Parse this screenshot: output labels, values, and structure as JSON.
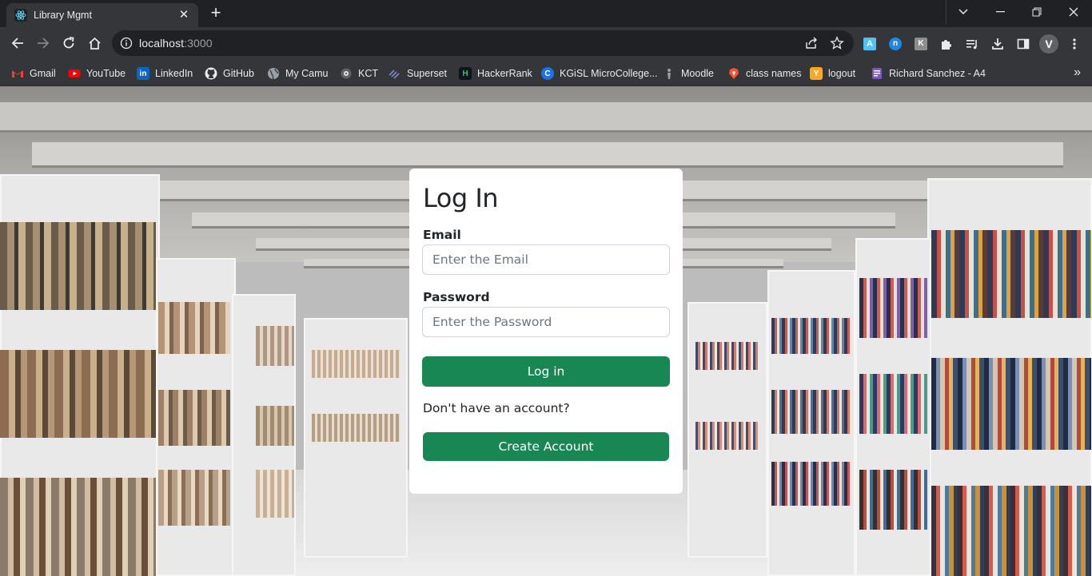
{
  "tab": {
    "title": "Library Mgmt",
    "close": "✕",
    "new_tab": "+"
  },
  "window": {
    "minimize": "—",
    "restore": "❐",
    "close": "✕",
    "tab_search": "⌄"
  },
  "address": {
    "host": "localhost",
    "port": ":3000"
  },
  "bookmarks": [
    {
      "label": "Gmail",
      "icon": "gmail-icon",
      "color": "#ea4335",
      "glyph": "M"
    },
    {
      "label": "YouTube",
      "icon": "youtube-icon",
      "color": "#ff0000",
      "glyph": "▶"
    },
    {
      "label": "LinkedIn",
      "icon": "linkedin-icon",
      "color": "#0a66c2",
      "glyph": "in"
    },
    {
      "label": "GitHub",
      "icon": "github-icon",
      "color": "#e8eaed",
      "glyph": ""
    },
    {
      "label": "My Camu",
      "icon": "globe-icon",
      "color": "#9aa0a6",
      "glyph": ""
    },
    {
      "label": "KCT",
      "icon": "kct-icon",
      "color": "#5f6368",
      "glyph": ""
    },
    {
      "label": "Superset",
      "icon": "superset-icon",
      "color": "#5c6bc0",
      "glyph": ""
    },
    {
      "label": "HackerRank",
      "icon": "hackerrank-icon",
      "color": "#0e141e",
      "glyph": "H"
    },
    {
      "label": "KGiSL MicroCollege...",
      "icon": "kgisl-icon",
      "color": "#1a73e8",
      "glyph": "C"
    },
    {
      "label": "Moodle",
      "icon": "moodle-icon",
      "color": "#9aa0a6",
      "glyph": ""
    },
    {
      "label": "class names",
      "icon": "brave-icon",
      "color": "#fb542b",
      "glyph": ""
    },
    {
      "label": "logout",
      "icon": "logout-icon",
      "color": "#f9a825",
      "glyph": "Y"
    },
    {
      "label": "Richard Sanchez - A4",
      "icon": "doc-icon",
      "color": "#7e57c2",
      "glyph": ""
    }
  ],
  "bookmarks_more": "»",
  "login": {
    "title": "Log In",
    "email_label": "Email",
    "email_placeholder": "Enter the Email",
    "password_label": "Password",
    "password_placeholder": "Enter the Password",
    "login_button": "Log in",
    "no_account_text": "Don't have an account?",
    "create_button": "Create Account"
  },
  "colors": {
    "primary_green": "#198754",
    "chrome_dark": "#202124",
    "chrome_toolbar": "#35363a"
  }
}
